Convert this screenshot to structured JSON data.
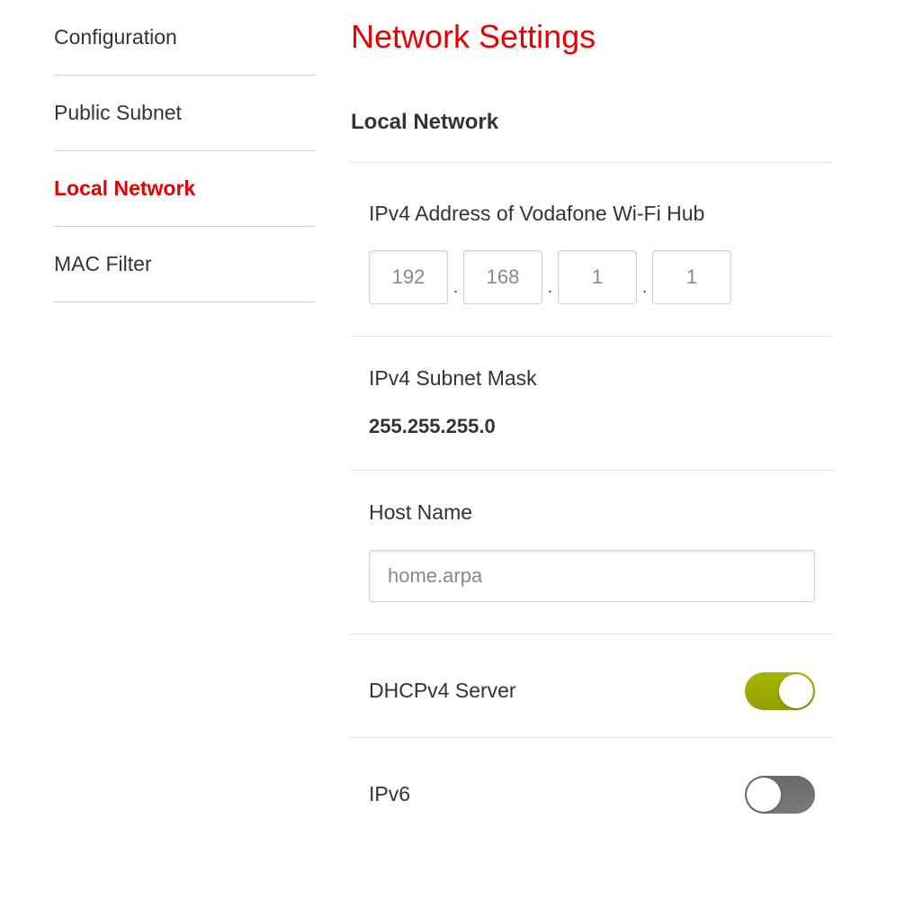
{
  "sidebar": {
    "items": [
      {
        "label": "Configuration",
        "active": false
      },
      {
        "label": "Public Subnet",
        "active": false
      },
      {
        "label": "Local Network",
        "active": true
      },
      {
        "label": "MAC Filter",
        "active": false
      }
    ]
  },
  "main": {
    "title": "Network Settings",
    "section": "Local Network",
    "ipv4_address": {
      "label": "IPv4 Address of Vodafone Wi-Fi Hub",
      "octets": [
        "192",
        "168",
        "1",
        "1"
      ]
    },
    "subnet_mask": {
      "label": "IPv4 Subnet Mask",
      "value": "255.255.255.0"
    },
    "hostname": {
      "label": "Host Name",
      "value": "home.arpa"
    },
    "dhcpv4": {
      "label": "DHCPv4 Server",
      "enabled": true
    },
    "ipv6": {
      "label": "IPv6",
      "enabled": false
    }
  }
}
